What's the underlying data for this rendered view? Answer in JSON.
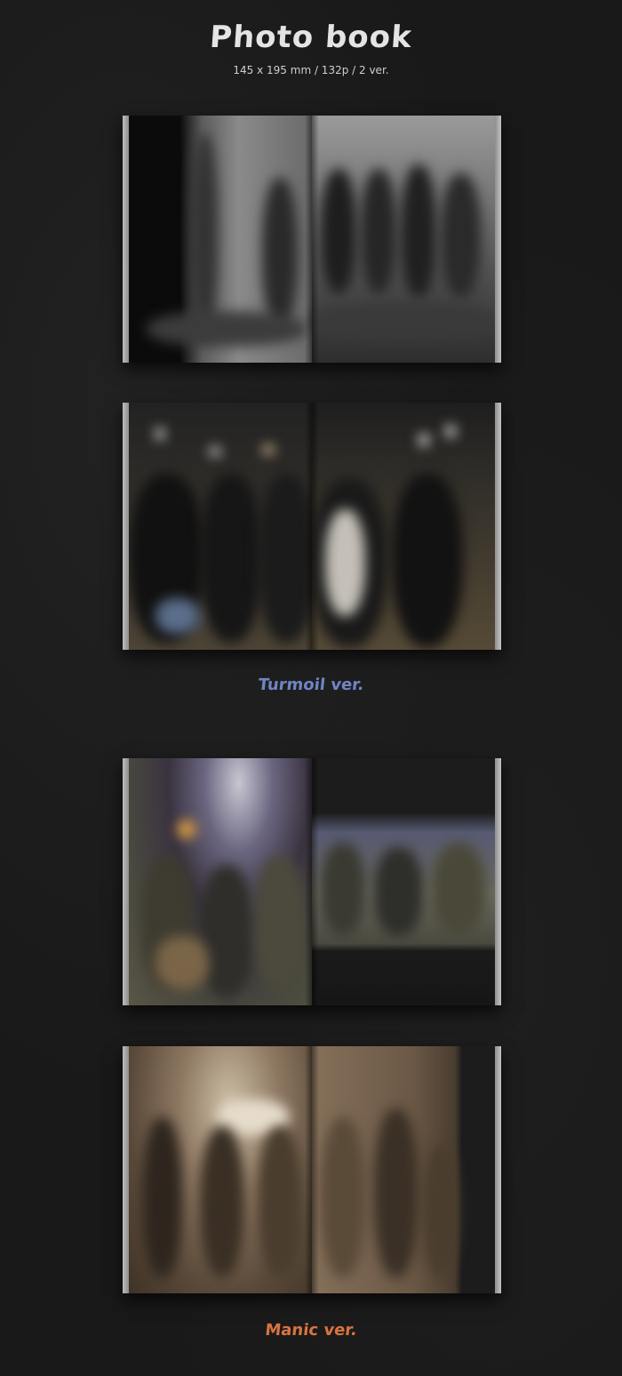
{
  "header": {
    "title": "Photo book",
    "subtitle": "145 x 195 mm / 132p / 2 ver."
  },
  "versions": [
    {
      "label": "Turmoil ver.",
      "color": "#6f84c4"
    },
    {
      "label": "Manic ver.",
      "color": "#d9733f"
    }
  ],
  "colors": {
    "background": "#191919",
    "text": "#e4e4e4"
  }
}
